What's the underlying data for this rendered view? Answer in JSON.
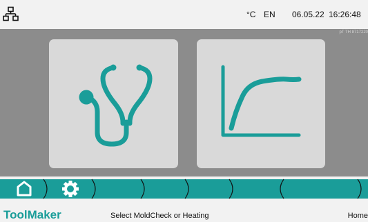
{
  "header": {
    "temperature_unit": "°C",
    "language": "EN",
    "date": "06.05.22",
    "time": "16:26:48",
    "serial": "pT TH 8717220",
    "network_icon": "network-icon"
  },
  "main": {
    "cards": [
      {
        "id": "moldcheck",
        "icon": "stethoscope-icon"
      },
      {
        "id": "heating",
        "icon": "heating-curve-icon"
      }
    ]
  },
  "navbar": {
    "items": [
      {
        "id": "home",
        "icon": "home-icon",
        "active": true
      },
      {
        "id": "settings",
        "icon": "gear-icon",
        "active": true
      },
      {
        "id": "slot-3",
        "icon": "",
        "active": true
      },
      {
        "id": "slot-4",
        "icon": "",
        "active": true
      },
      {
        "id": "slot-5",
        "icon": "",
        "active": true
      },
      {
        "id": "slot-6",
        "icon": "",
        "active": true
      },
      {
        "id": "slot-7",
        "icon": "",
        "active": true
      }
    ]
  },
  "statusbar": {
    "brand": "ToolMaker",
    "message": "Select MoldCheck or Heating",
    "screen": "Home"
  },
  "colors": {
    "accent": "#1a9d99",
    "background": "#8c8c8c",
    "card": "#d9d9d9",
    "bar": "#f2f2f2"
  }
}
